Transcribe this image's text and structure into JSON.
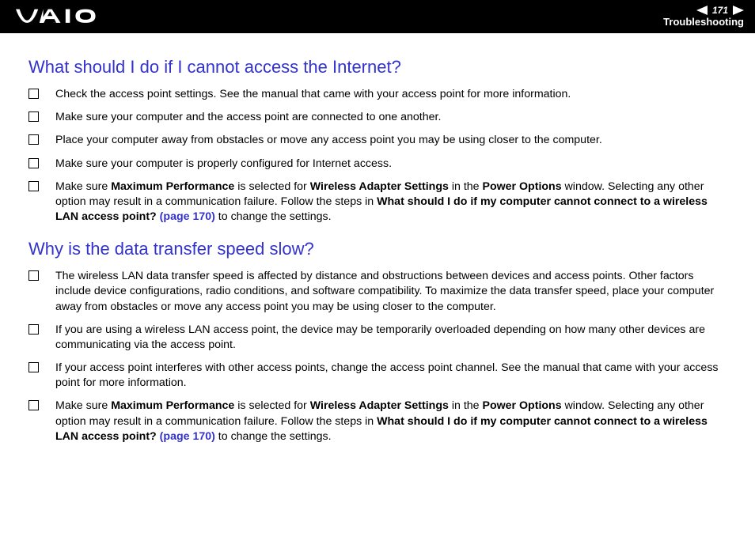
{
  "header": {
    "page_number": "171",
    "section": "Troubleshooting"
  },
  "section1": {
    "heading": "What should I do if I cannot access the Internet?",
    "items": {
      "i0": "Check the access point settings. See the manual that came with your access point for more information.",
      "i1": "Make sure your computer and the access point are connected to one another.",
      "i2": "Place your computer away from obstacles or move any access point you may be using closer to the computer.",
      "i3": "Make sure your computer is properly configured for Internet access.",
      "i4_pre": "Make sure ",
      "i4_b1": "Maximum Performance",
      "i4_mid1": " is selected for ",
      "i4_b2": "Wireless Adapter Settings",
      "i4_mid2": " in the ",
      "i4_b3": "Power Options",
      "i4_mid3": " window. Selecting any other option may result in a communication failure. Follow the steps in ",
      "i4_b4": "What should I do if my computer cannot connect to a wireless LAN access point? ",
      "i4_link": "(page 170)",
      "i4_end": " to change the settings."
    }
  },
  "section2": {
    "heading": "Why is the data transfer speed slow?",
    "items": {
      "i0": "The wireless LAN data transfer speed is affected by distance and obstructions between devices and access points. Other factors include device configurations, radio conditions, and software compatibility. To maximize the data transfer speed, place your computer away from obstacles or move any access point you may be using closer to the computer.",
      "i1": "If you are using a wireless LAN access point, the device may be temporarily overloaded depending on how many other devices are communicating via the access point.",
      "i2": "If your access point interferes with other access points, change the access point channel. See the manual that came with your access point for more information.",
      "i3_pre": "Make sure ",
      "i3_b1": "Maximum Performance",
      "i3_mid1": " is selected for ",
      "i3_b2": "Wireless Adapter Settings",
      "i3_mid2": " in the ",
      "i3_b3": "Power Options",
      "i3_mid3": " window. Selecting any other option may result in a communication failure. Follow the steps in ",
      "i3_b4": "What should I do if my computer cannot connect to a wireless LAN access point? ",
      "i3_link": "(page 170)",
      "i3_end": " to change the settings."
    }
  }
}
